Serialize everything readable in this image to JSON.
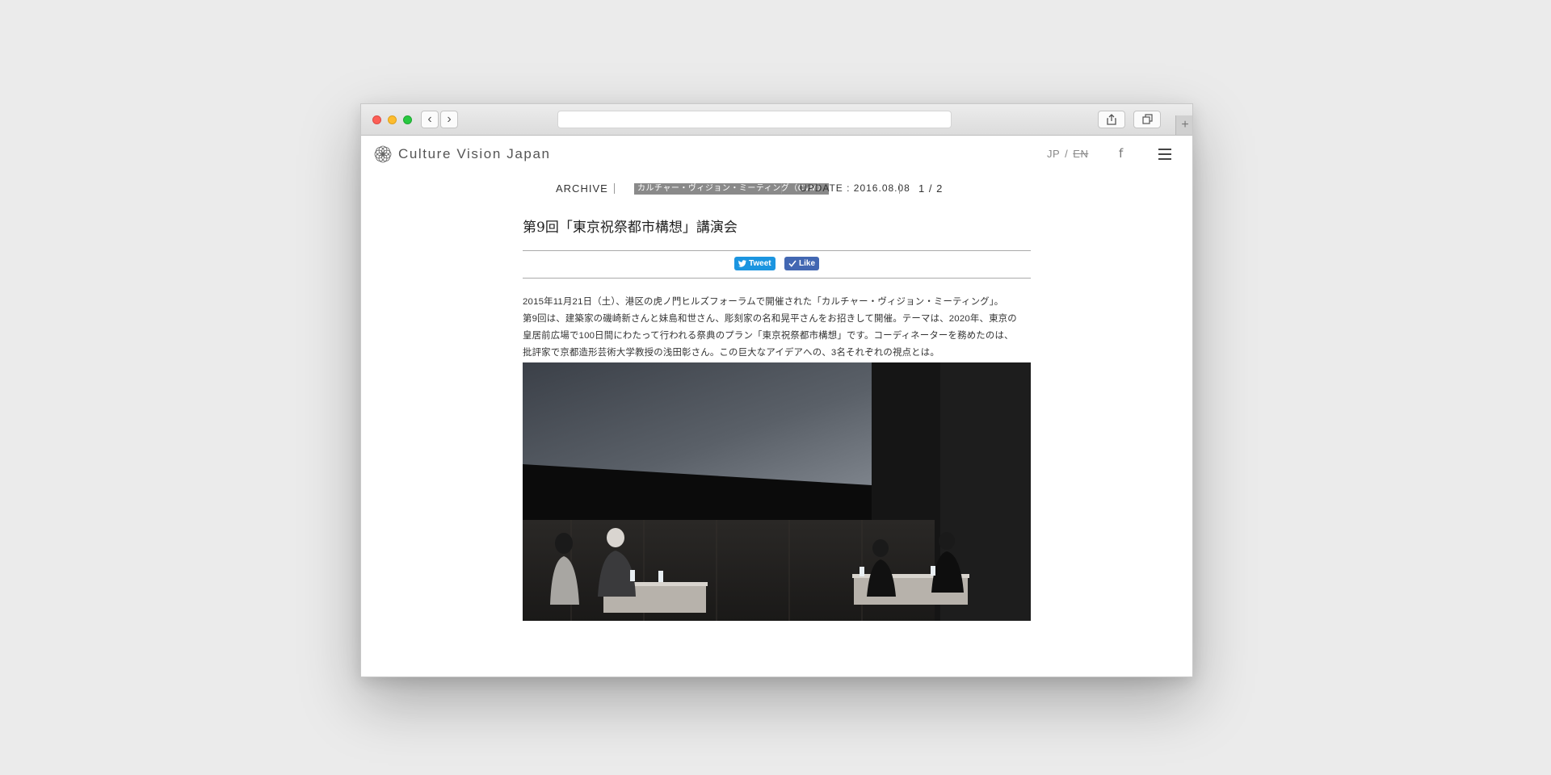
{
  "browser": {
    "back_glyph": "‹",
    "forward_glyph": "›",
    "new_tab_glyph": "+",
    "icons": [
      "share-icon",
      "tabs-icon"
    ]
  },
  "site": {
    "logo_text": "Culture Vision Japan",
    "lang_jp": "JP",
    "lang_sep": "/",
    "lang_en": "EN",
    "facebook_glyph": "f"
  },
  "meta": {
    "archive": "ARCHIVE",
    "category": "カルチャー・ヴィジョン・ミーティング（CVM）",
    "update": "UPDATE : 2016.08.08",
    "pager": "1 / 2"
  },
  "article": {
    "title": "第9回「東京祝祭都市構想」講演会",
    "tweet_label": "Tweet",
    "like_label": "Like",
    "body_lines": [
      "2015年11月21日（土）、港区の虎ノ門ヒルズフォーラムで開催された「カルチャー・ヴィジョン・ミーティング」。",
      "第9回は、建築家の磯崎新さんと妹島和世さん、彫刻家の名和晃平さんをお招きして開催。テーマは、2020年、東京の",
      "皇居前広場で100日間にわたって行われる祭典のプラン「東京祝祭都市構想」です。コーディネーターを務めたのは、",
      "批評家で京都造形芸術大学教授の浅田彰さん。この巨大なアイデアへの、3名それぞれの視点とは。"
    ]
  },
  "colors": {
    "twitter": "#1b95e0",
    "facebook": "#4267b2",
    "category_bg": "#8a8a8a"
  }
}
